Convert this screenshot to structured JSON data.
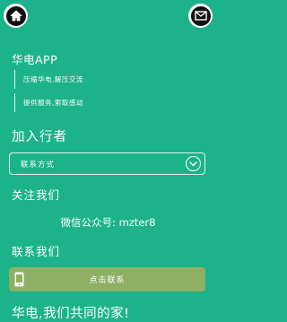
{
  "header": {
    "home_icon": "home-icon",
    "mail_icon": "mail-icon"
  },
  "app": {
    "name": "华电APP",
    "slogans": [
      "压缩华电,解压交流",
      "提供服务,索取感动"
    ]
  },
  "join": {
    "title": "加入行者",
    "select_value": "联系方式",
    "select_icon": "chevron-down-icon"
  },
  "follow": {
    "title": "关注我们",
    "wechat_text": "微信公众号: mzter8"
  },
  "contact": {
    "title": "联系我们",
    "button_label": "点击联系",
    "button_icon": "phone-icon"
  },
  "footer": {
    "tagline": "华电,我们共同的家!"
  },
  "colors": {
    "background": "#1db38a",
    "button": "#8eb065",
    "text": "#ffffff"
  }
}
